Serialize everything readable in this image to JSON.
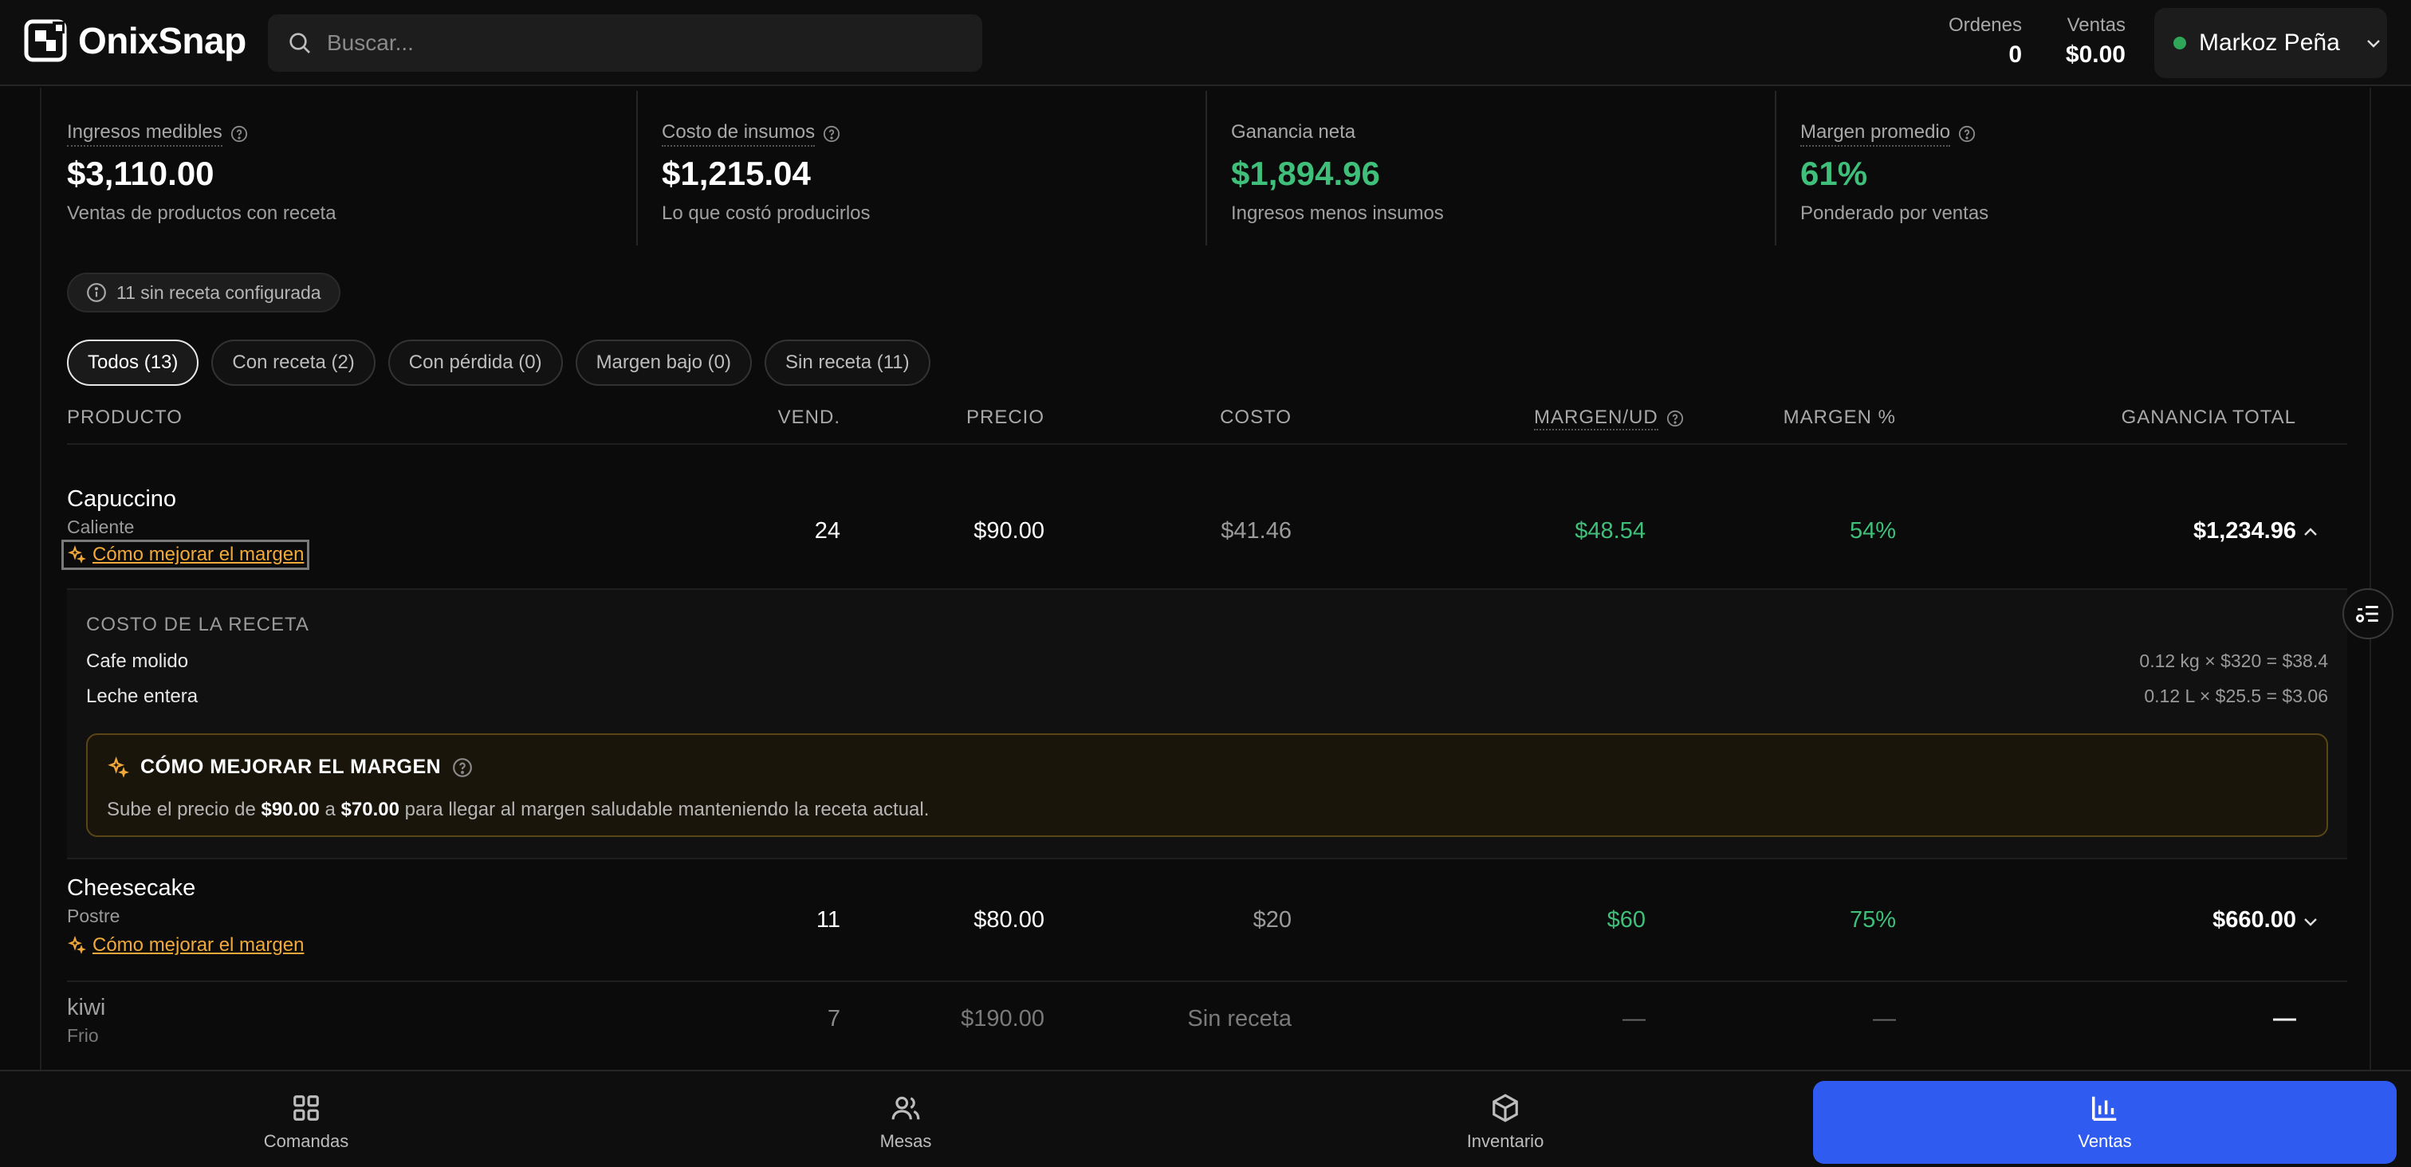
{
  "header": {
    "brand": "OnixSnap",
    "search_placeholder": "Buscar...",
    "orders_label": "Ordenes",
    "orders_value": "0",
    "sales_label": "Ventas",
    "sales_value": "$0.00",
    "user_name": "Markoz Peña",
    "user_status_color": "#2fa55a"
  },
  "metrics": [
    {
      "label": "Ingresos medibles",
      "value": "$3,110.00",
      "sub": "Ventas de productos con receta"
    },
    {
      "label": "Costo de insumos",
      "value": "$1,215.04",
      "sub": "Lo que costó producirlos"
    },
    {
      "label": "Ganancia neta",
      "value": "$1,894.96",
      "sub": "Ingresos menos insumos"
    },
    {
      "label": "Margen promedio",
      "value": "61%",
      "sub": "Ponderado por ventas"
    }
  ],
  "notice": "11 sin receta configurada",
  "tabs": [
    "Todos (13)",
    "Con receta (2)",
    "Con pérdida (0)",
    "Margen bajo (0)",
    "Sin receta (11)"
  ],
  "columns": {
    "product": "PRODUCTO",
    "sold": "VEND.",
    "price": "PRECIO",
    "cost": "COSTO",
    "margin_unit": "MARGEN/UD",
    "margin_pct": "MARGEN %",
    "total": "GANANCIA TOTAL"
  },
  "rows": [
    {
      "name": "Capuccino",
      "category": "Caliente",
      "improve": "Cómo mejorar el margen",
      "sold": "24",
      "price": "$90.00",
      "cost": "$41.46",
      "margin_unit": "$48.54",
      "margin_pct": "54%",
      "total": "$1,234.96"
    },
    {
      "name": "Cheesecake",
      "category": "Postre",
      "improve": "Cómo mejorar el margen",
      "sold": "11",
      "price": "$80.00",
      "cost": "$20",
      "margin_unit": "$60",
      "margin_pct": "75%",
      "total": "$660.00"
    },
    {
      "name": "kiwi",
      "category": "Frio",
      "sold": "7",
      "price": "$190.00",
      "cost": "Sin receta",
      "margin_unit": "—",
      "margin_pct": "—",
      "total": "—"
    }
  ],
  "detail": {
    "title": "COSTO DE LA RECETA",
    "ingredients": [
      {
        "name": "Cafe molido",
        "calc": "0.12 kg × $320 = $38.4"
      },
      {
        "name": "Leche entera",
        "calc": "0.12 L × $25.5 = $3.06"
      }
    ],
    "tip_title": "CÓMO MEJORAR EL MARGEN",
    "tip_prefix": "Sube el precio de",
    "tip_from": "$90.00",
    "tip_mid": "a",
    "tip_to": "$70.00",
    "tip_suffix": "para llegar al margen saludable manteniendo la receta actual."
  },
  "bottom_nav": [
    "Comandas",
    "Mesas",
    "Inventario",
    "Ventas"
  ],
  "colors": {
    "accent": "#2f5bf0",
    "positive": "#3fbf7a",
    "warning": "#f0a93a"
  }
}
